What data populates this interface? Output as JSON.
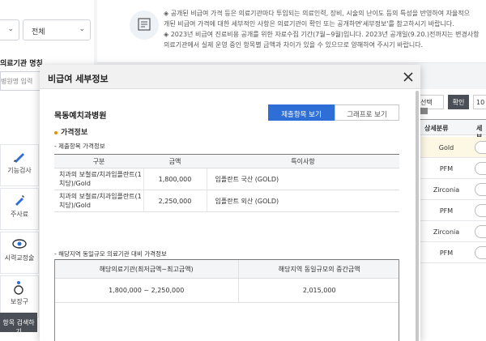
{
  "background": {
    "select_left_value": "",
    "select_right_value": "전체",
    "hospital_label": "의료기관 명칭",
    "hospital_input_placeholder": "병원명 입력",
    "icon_cards": [
      "기능검사",
      "주사료",
      "시력교정술",
      "보장구"
    ],
    "search_button": "항목 검색하기",
    "notice_lines": [
      "◈ 공개된 비급여 가격 등은 의료기관마다 투입되는 의료인력, 장비, 시술의 난이도 등의 특성을 반영하여 자율적으",
      "개된 비급여 가격에 대한 세부적인 사항은 의료기관이 확인 또는 공개하면'세부정보'를 참고하시기 바랍니다.",
      "◈ 2023년 비급여 진료비용 공개를 위한 자료수집 기간(7월~9월)입니다. 2023년 공개일(9.20.)전까지는 변경사항",
      "의료기관에서 실제 운영 중인 항목별 금액과 차이가 있을 수 있으므로 양해하여 주시기 바랍니다."
    ],
    "select_label": "선택",
    "confirm_button": "확인",
    "page_input": "10",
    "col_header": "상세분류",
    "col_header2": "세부",
    "rows": [
      "Gold",
      "PFM",
      "Zirconia",
      "PFM",
      "Zirconia",
      "PFM"
    ]
  },
  "modal": {
    "title": "비급여 세부정보",
    "hospital_name": "목동예치과병원",
    "btn_table": "제출항목 보기",
    "btn_graph": "그래프로 보기",
    "section_title": "가격정보",
    "table1_caption": "- 제출항목 가격정보",
    "table1_headers": [
      "구분",
      "금액",
      "특이사항"
    ],
    "table1_rows": [
      {
        "item": "치과의 보철료/치과임플란트(1치당)/Gold",
        "amount": "1,800,000",
        "note": "임플란트 국산 (GOLD)"
      },
      {
        "item": "치과의 보철료/치과임플란트(1치당)/Gold",
        "amount": "2,250,000",
        "note": "임플란트 외산 (GOLD)"
      }
    ],
    "table2_caption": "- 해당지역 동일규모 의료기관 대비 가격정보",
    "table2_headers": [
      "해당의료기관(최저금액~최고금액)",
      "해당지역 동일규모의 중간금액"
    ],
    "table2_row": {
      "range": "1,800,000 ~ 2,250,000",
      "median": "2,015,000"
    }
  }
}
